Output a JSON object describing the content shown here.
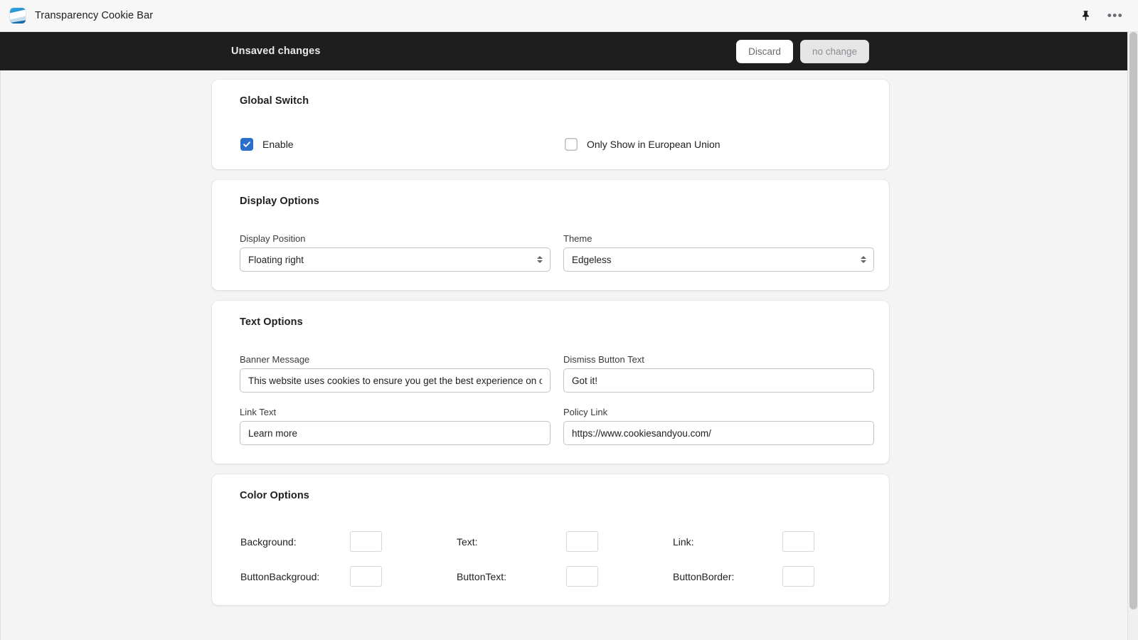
{
  "app": {
    "icon": "app-wave-icon",
    "title": "Transparency Cookie Bar",
    "pin_icon": "pin-icon",
    "more_icon": "more-options-icon"
  },
  "save_bar": {
    "title": "Unsaved changes",
    "discard_label": "Discard",
    "save_label": "no change"
  },
  "sections": {
    "global_switch": {
      "title": "Global Switch",
      "enable": {
        "label": "Enable",
        "checked": true
      },
      "eu_only": {
        "label": "Only Show in European Union",
        "checked": false
      }
    },
    "display_options": {
      "title": "Display Options",
      "display_position": {
        "label": "Display Position",
        "value": "Floating right",
        "options": [
          "Floating right"
        ]
      },
      "theme": {
        "label": "Theme",
        "value": "Edgeless",
        "options": [
          "Edgeless"
        ]
      }
    },
    "text_options": {
      "title": "Text Options",
      "banner_message": {
        "label": "Banner Message",
        "value": "This website uses cookies to ensure you get the best experience on our website."
      },
      "dismiss_button_text": {
        "label": "Dismiss Button Text",
        "value": "Got it!"
      },
      "link_text": {
        "label": "Link Text",
        "value": "Learn more"
      },
      "policy_link": {
        "label": "Policy Link",
        "value": "https://www.cookiesandyou.com/"
      }
    },
    "color_options": {
      "title": "Color Options",
      "items": [
        {
          "label": "Background:",
          "color": "#3f3f3f"
        },
        {
          "label": "Text:",
          "color": "#ffffff"
        },
        {
          "label": "Link:",
          "color": "#ffffff"
        },
        {
          "label": "ButtonBackgroud:",
          "color": "#f1dd37"
        },
        {
          "label": "ButtonText:",
          "color": "#ffffff"
        },
        {
          "label": "ButtonBorder:",
          "color": "#ffffff"
        }
      ]
    }
  },
  "theme_colors": {
    "save_bar_background": "#1e1e1e",
    "page_background": "#f4f4f4",
    "card_background": "#ffffff",
    "checkbox_accent": "#2c6ecb"
  }
}
